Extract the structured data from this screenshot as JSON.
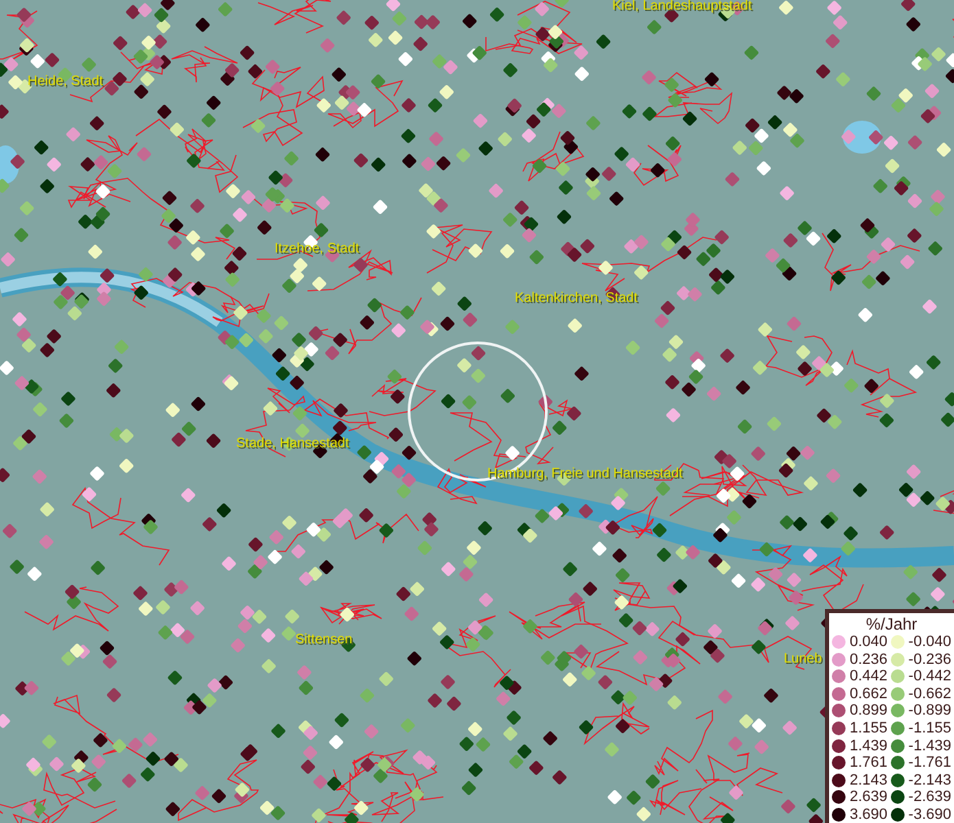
{
  "map": {
    "places": [
      {
        "name": "Kiel, Landeshauptstadt"
      },
      {
        "name": "Heide, Stadt"
      },
      {
        "name": "Itzehoe, Stadt"
      },
      {
        "name": "Kaltenkirchen, Stadt"
      },
      {
        "name": "Stade, Hansestadt"
      },
      {
        "name": "Hamburg, Freie und Hansestadt"
      },
      {
        "name": "Sittensen"
      },
      {
        "name": "Luneb"
      }
    ]
  },
  "legend": {
    "title": "%/Jahr",
    "rows": [
      {
        "positive": {
          "label": "0.040",
          "color": "#f4b6e0"
        },
        "negative": {
          "label": "-0.040",
          "color": "#f0f7c0"
        }
      },
      {
        "positive": {
          "label": "0.236",
          "color": "#e39bc8"
        },
        "negative": {
          "label": "-0.236",
          "color": "#d6eaa6"
        }
      },
      {
        "positive": {
          "label": "0.442",
          "color": "#d07fa8"
        },
        "negative": {
          "label": "-0.442",
          "color": "#b9dc90"
        }
      },
      {
        "positive": {
          "label": "0.662",
          "color": "#c46a92"
        },
        "negative": {
          "label": "-0.662",
          "color": "#98cb78"
        }
      },
      {
        "positive": {
          "label": "0.899",
          "color": "#ad4f73"
        },
        "negative": {
          "label": "-0.899",
          "color": "#79b862"
        }
      },
      {
        "positive": {
          "label": "1.155",
          "color": "#963a58"
        },
        "negative": {
          "label": "-1.155",
          "color": "#5ea24e"
        }
      },
      {
        "positive": {
          "label": "1.439",
          "color": "#7f2540"
        },
        "negative": {
          "label": "-1.439",
          "color": "#458c3c"
        }
      },
      {
        "positive": {
          "label": "1.761",
          "color": "#67152b"
        },
        "negative": {
          "label": "-1.761",
          "color": "#2c722a"
        }
      },
      {
        "positive": {
          "label": "2.143",
          "color": "#4c0b1a"
        },
        "negative": {
          "label": "-2.143",
          "color": "#175a1b"
        }
      },
      {
        "positive": {
          "label": "2.639",
          "color": "#35050f"
        },
        "negative": {
          "label": "-2.639",
          "color": "#0b4512"
        }
      },
      {
        "positive": {
          "label": "3.690",
          "color": "#200008"
        },
        "negative": {
          "label": "-3.690",
          "color": "#04300a"
        }
      }
    ]
  }
}
